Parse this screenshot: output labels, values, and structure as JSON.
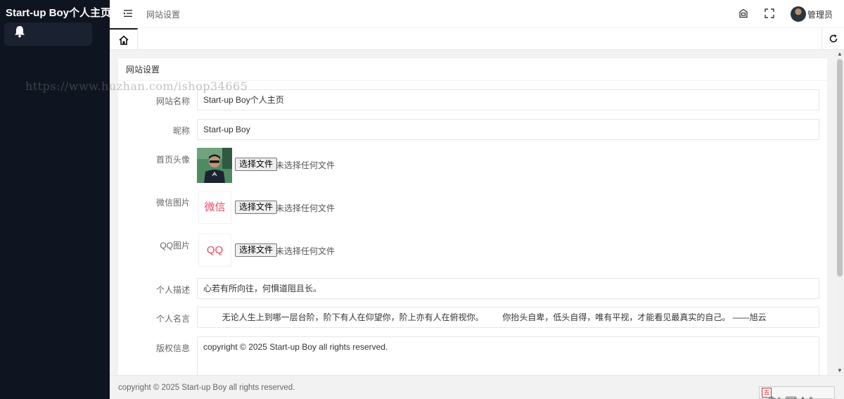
{
  "sidebar": {
    "logo": "Start-up Boy个人主页",
    "items": [
      {
        "icon": "bell-icon"
      }
    ]
  },
  "header": {
    "breadcrumb": "网站设置",
    "user_name": "管理员",
    "icons": [
      "menu-toggle-icon",
      "theme-icon",
      "fullscreen-icon"
    ]
  },
  "tabs": {
    "home_icon": "home-icon",
    "refresh_icon": "refresh-icon"
  },
  "card": {
    "title": "网站设置",
    "fields": [
      {
        "label": "网站名称",
        "value": "Start-up Boy个人主页"
      },
      {
        "label": "昵称",
        "value": "Start-up Boy"
      },
      {
        "label": "首页头像",
        "button": "选择文件",
        "status": "未选择任何文件"
      },
      {
        "label": "微信图片",
        "image_text": "微信",
        "button": "选择文件",
        "status": "未选择任何文件"
      },
      {
        "label": "QQ图片",
        "image_text": "QQ",
        "button": "选择文件",
        "status": "未选择任何文件"
      },
      {
        "label": "个人描述",
        "value": "心若有所向往，何惧道阻且长。"
      },
      {
        "label": "个人名言",
        "value": "        无论人生上到哪一层台阶，阶下有人在仰望你，阶上亦有人在俯视你。        你抬头自卑，低头自得，唯有平视，才能看见最真实的自己。 ——旭云"
      },
      {
        "label": "版权信息",
        "value": "copyright © 2025 Start-up Boy all rights reserved."
      }
    ]
  },
  "footer": {
    "text": "copyright © 2025 Start-up Boy all rights reserved."
  },
  "ime": {
    "mode": "中",
    "symbols": "☽ °, ⌨ ♟ ✎"
  },
  "watermark": "https://www.huzhan.com/ishop34665",
  "colors": {
    "sidebar_bg": "#0f1520",
    "accent_pink": "#e64a62"
  }
}
